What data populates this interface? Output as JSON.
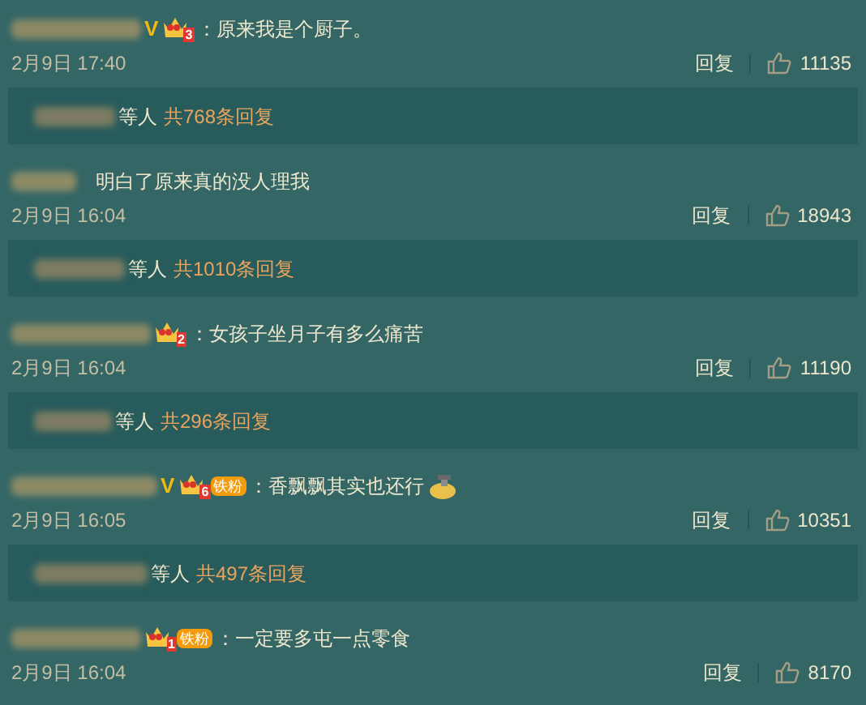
{
  "comments": [
    {
      "verified_mark": "V",
      "crown_level": "3",
      "text": "：原来我是个厨子。",
      "sticker": false,
      "date": "2月9日 17:40",
      "reply_label": "回复",
      "like_count": "11135",
      "thread": {
        "suffix": "等人",
        "count_text": "共768条回复"
      }
    },
    {
      "text": "明白了原来真的没人理我",
      "sticker": false,
      "date": "2月9日 16:04",
      "reply_label": "回复",
      "like_count": "18943",
      "thread": {
        "suffix": "等人",
        "count_text": "共1010条回复"
      }
    },
    {
      "crown_level": "2",
      "text": "：女孩子坐月子有多么痛苦",
      "sticker": false,
      "date": "2月9日 16:04",
      "reply_label": "回复",
      "like_count": "11190",
      "thread": {
        "suffix": "等人",
        "count_text": "共296条回复"
      }
    },
    {
      "verified_mark": "V",
      "crown_level": "6",
      "fan_badge": "铁粉",
      "text": "：香飘飘其实也还行",
      "sticker": true,
      "date": "2月9日 16:05",
      "reply_label": "回复",
      "like_count": "10351",
      "thread": {
        "suffix": "等人",
        "count_text": "共497条回复"
      }
    },
    {
      "crown_level": "1",
      "fan_badge": "铁粉",
      "text": "：一定要多屯一点零食",
      "sticker": false,
      "date": "2月9日 16:04",
      "reply_label": "回复",
      "like_count": "8170"
    }
  ]
}
